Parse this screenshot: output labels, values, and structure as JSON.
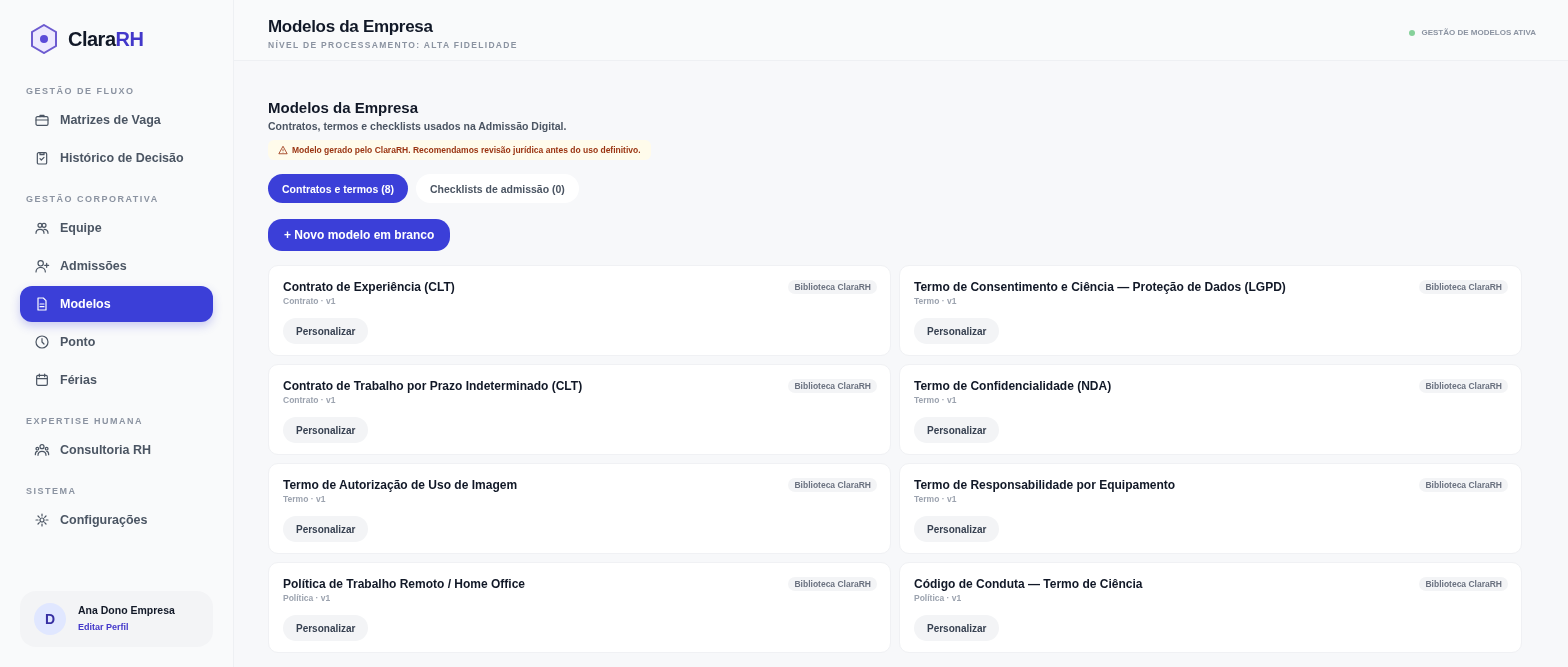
{
  "brand": {
    "name": "Clara",
    "accent": "RH"
  },
  "sidebar": {
    "sections": [
      {
        "title": "GESTÃO DE FLUXO",
        "items": [
          {
            "label": "Matrizes de Vaga",
            "selected": false
          },
          {
            "label": "Histórico de Decisão",
            "selected": false
          }
        ]
      },
      {
        "title": "GESTÃO CORPORATIVA",
        "items": [
          {
            "label": "Equipe",
            "selected": false
          },
          {
            "label": "Admissões",
            "selected": false
          },
          {
            "label": "Modelos",
            "selected": true
          },
          {
            "label": "Ponto",
            "selected": false
          },
          {
            "label": "Férias",
            "selected": false
          }
        ]
      },
      {
        "title": "EXPERTISE HUMANA",
        "items": [
          {
            "label": "Consultoria RH",
            "selected": false
          }
        ]
      },
      {
        "title": "SISTEMA",
        "items": [
          {
            "label": "Configurações",
            "selected": false
          }
        ]
      }
    ]
  },
  "user": {
    "initial": "D",
    "name": "Ana Dono Empresa",
    "link": "Editar Perfil"
  },
  "header": {
    "title": "Modelos da Empresa",
    "subtitle": "NÍVEL DE PROCESSAMENTO: ALTA FIDELIDADE",
    "status": "GESTÃO DE MODELOS ATIVA"
  },
  "page": {
    "title": "Modelos da Empresa",
    "description": "Contratos, termos e checklists usados na Admissão Digital.",
    "warning": "Modelo gerado pelo ClaraRH. Recomendamos revisão jurídica antes do uso definitivo.",
    "tabs": [
      {
        "label": "Contratos e termos (8)",
        "selected": true
      },
      {
        "label": "Checklists de admissão (0)",
        "selected": false
      }
    ],
    "new_button": "+ Novo modelo em branco",
    "templates": [
      {
        "title": "Contrato de Experiência (CLT)",
        "meta": "Contrato · v1",
        "badge": "Biblioteca ClaraRH",
        "action": "Personalizar"
      },
      {
        "title": "Termo de Consentimento e Ciência — Proteção de Dados (LGPD)",
        "meta": "Termo · v1",
        "badge": "Biblioteca ClaraRH",
        "action": "Personalizar"
      },
      {
        "title": "Contrato de Trabalho por Prazo Indeterminado (CLT)",
        "meta": "Contrato · v1",
        "badge": "Biblioteca ClaraRH",
        "action": "Personalizar"
      },
      {
        "title": "Termo de Confidencialidade (NDA)",
        "meta": "Termo · v1",
        "badge": "Biblioteca ClaraRH",
        "action": "Personalizar"
      },
      {
        "title": "Termo de Autorização de Uso de Imagem",
        "meta": "Termo · v1",
        "badge": "Biblioteca ClaraRH",
        "action": "Personalizar"
      },
      {
        "title": "Termo de Responsabilidade por Equipamento",
        "meta": "Termo · v1",
        "badge": "Biblioteca ClaraRH",
        "action": "Personalizar"
      },
      {
        "title": "Política de Trabalho Remoto / Home Office",
        "meta": "Política · v1",
        "badge": "Biblioteca ClaraRH",
        "action": "Personalizar"
      },
      {
        "title": "Código de Conduta — Termo de Ciência",
        "meta": "Política · v1",
        "badge": "Biblioteca ClaraRH",
        "action": "Personalizar"
      }
    ]
  }
}
